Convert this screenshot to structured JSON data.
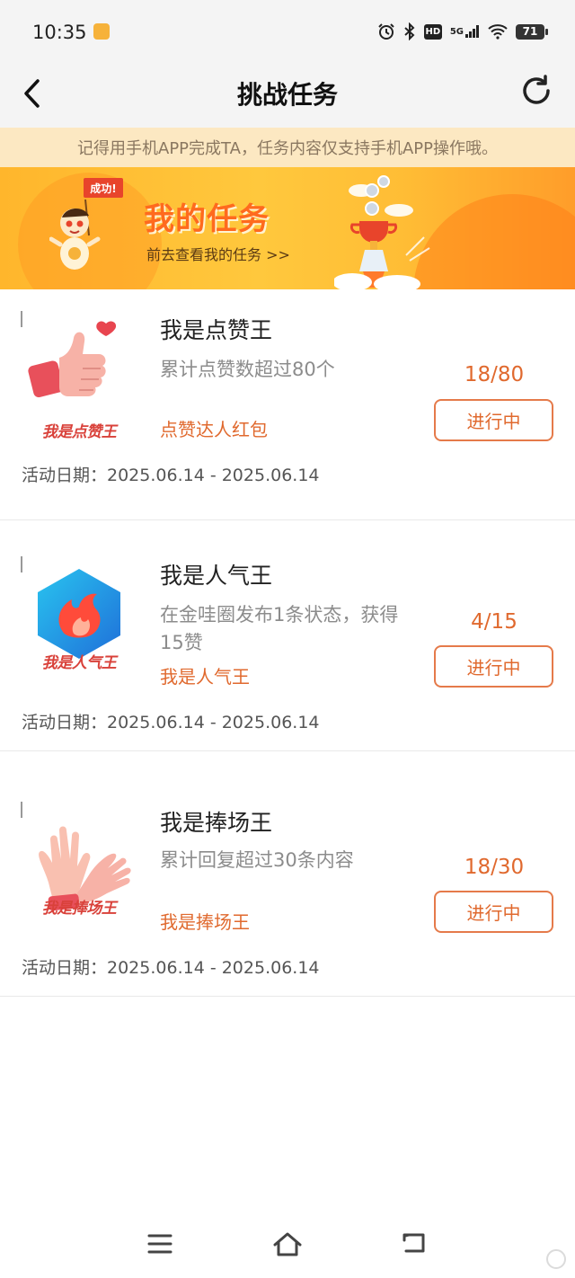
{
  "status_bar": {
    "time": "10:35",
    "hd": "HD",
    "network": "5G",
    "battery": "71"
  },
  "header": {
    "title": "挑战任务",
    "back_icon": "chevron-left-icon",
    "refresh_icon": "refresh-icon"
  },
  "notice": {
    "text": "记得用手机APP完成TA，任务内容仅支持手机APP操作哦。"
  },
  "banner": {
    "flag": "成功!",
    "title": "我的任务",
    "link": "前去查看我的任务 >>"
  },
  "tasks": [
    {
      "icon": "thumbs-up-icon",
      "icon_caption": "我是点赞王",
      "title": "我是点赞王",
      "desc": "累计点赞数超过80个",
      "reward": "点赞达人红包",
      "progress": "18/80",
      "status": "进行中",
      "date": "活动日期：2025.06.14 - 2025.06.14"
    },
    {
      "icon": "flame-hexagon-icon",
      "icon_caption": "我是人气王",
      "title": "我是人气王",
      "desc": "在金哇圈发布1条状态，获得15赞",
      "reward": "我是人气王",
      "progress": "4/15",
      "status": "进行中",
      "date": "活动日期：2025.06.14 - 2025.06.14"
    },
    {
      "icon": "clapping-hands-icon",
      "icon_caption": "我是捧场王",
      "title": "我是捧场王",
      "desc": "累计回复超过30条内容",
      "reward": "我是捧场王",
      "progress": "18/30",
      "status": "进行中",
      "date": "活动日期：2025.06.14 - 2025.06.14"
    }
  ],
  "colors": {
    "accent": "#e0692e",
    "notice_bg": "#fce8c2",
    "banner_bg": "#ffc83d",
    "caption_red": "#d9413a"
  }
}
